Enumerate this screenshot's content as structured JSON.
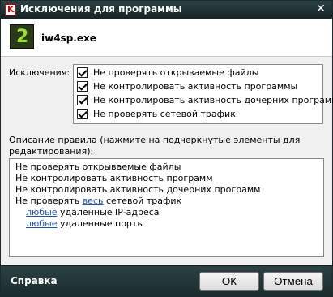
{
  "window": {
    "title": "Исключения для программы"
  },
  "app": {
    "name": "iw4sp.exe"
  },
  "exclusions": {
    "label": "Исключения:",
    "items": [
      {
        "label": "Не проверять открываемые файлы",
        "checked": true
      },
      {
        "label": "Не контролировать активность программы",
        "checked": true
      },
      {
        "label": "Не контролировать активность дочерних программ",
        "checked": true
      },
      {
        "label": "Не проверять сетевой трафик",
        "checked": true
      }
    ]
  },
  "description": {
    "label": "Описание правила (нажмите на подчеркнутые элементы для редактирования):",
    "lines": {
      "l1": "Не проверять открываемые файлы",
      "l2": "Не контролировать активность программ",
      "l3": "Не контролировать активность дочерних программ",
      "l4_prefix": "Не проверять ",
      "l4_link": "весь",
      "l4_suffix": " сетевой трафик",
      "l5_link": "любые",
      "l5_suffix": " удаленные IP-адреса",
      "l6_link": "любые",
      "l6_suffix": " удаленные порты"
    }
  },
  "footer": {
    "help": "Справка",
    "ok": "ОК",
    "cancel": "Отмена"
  }
}
